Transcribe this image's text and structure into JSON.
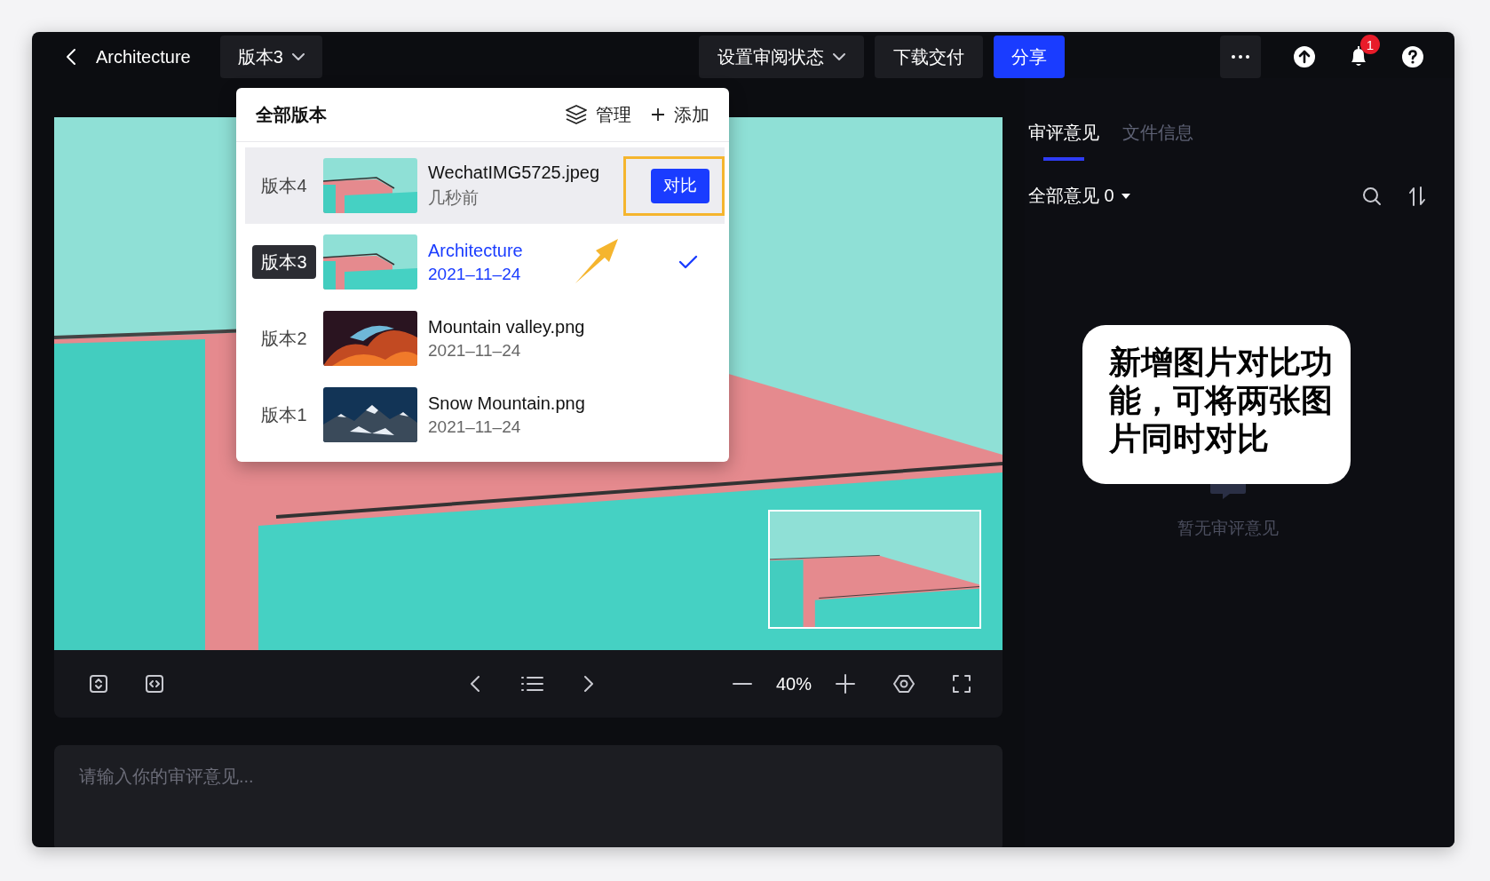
{
  "header": {
    "title": "Architecture",
    "version_button": "版本3",
    "actions": [
      {
        "kind": "dropdown",
        "label": "设置审阅状态"
      },
      {
        "kind": "plain",
        "label": "下载交付"
      },
      {
        "kind": "primary",
        "label": "分享"
      }
    ],
    "notification_count": "1"
  },
  "version_menu": {
    "title": "全部版本",
    "manage": "管理",
    "add": "添加",
    "versions": [
      {
        "version": "版本4",
        "name": "WechatIMG5725.jpeg",
        "time": "几秒前",
        "kind": "building",
        "hovered": true,
        "selected": false,
        "compare_button": "对比",
        "highlighted": true
      },
      {
        "version": "版本3",
        "name": "Architecture",
        "time": "2021–11–24",
        "kind": "building",
        "hovered": false,
        "selected": true
      },
      {
        "version": "版本2",
        "name": "Mountain valley.png",
        "time": "2021–11–24",
        "kind": "canyon",
        "hovered": false,
        "selected": false
      },
      {
        "version": "版本1",
        "name": "Snow Mountain.png",
        "time": "2021–11–24",
        "kind": "mountain",
        "hovered": false,
        "selected": false
      }
    ]
  },
  "viewer": {
    "zoom": "40%"
  },
  "comment_input": {
    "placeholder": "请输入你的审评意见..."
  },
  "side_panel": {
    "tabs": [
      {
        "label": "审评意见",
        "selected": true
      },
      {
        "label": "文件信息",
        "selected": false
      }
    ],
    "filter": "全部意见 0",
    "empty_text": "暂无审评意见"
  },
  "callout": "新增图片对比功能，可将两张图片同时对比"
}
